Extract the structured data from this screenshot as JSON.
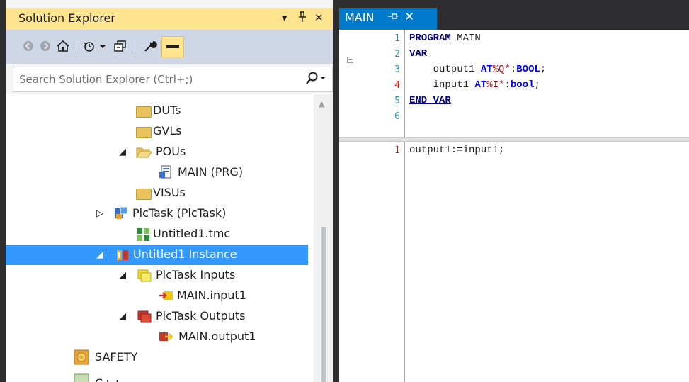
{
  "solution_explorer": {
    "title": "Solution Explorer",
    "dropdown_glyph": "▾",
    "pin_glyph": "ᛘ",
    "close_glyph": "✕",
    "search_placeholder": "Search Solution Explorer (Ctrl+;)",
    "toolbar_icons": [
      "back-icon",
      "forward-icon",
      "home-icon",
      "history-icon",
      "collapse-all-icon",
      "properties-icon",
      "preview-icon"
    ],
    "tree": [
      {
        "label": "DUTs",
        "icon": "folder-icon",
        "expander": ""
      },
      {
        "label": "GVLs",
        "icon": "folder-icon",
        "expander": ""
      },
      {
        "label": "POUs",
        "icon": "folder-open-icon",
        "expander": "◢"
      },
      {
        "label": "MAIN (PRG)",
        "icon": "program-icon",
        "expander": ""
      },
      {
        "label": "VISUs",
        "icon": "folder-icon",
        "expander": ""
      },
      {
        "label": "PlcTask (PlcTask)",
        "icon": "task-icon",
        "expander": "▷"
      },
      {
        "label": "Untitled1.tmc",
        "icon": "tmc-icon",
        "expander": ""
      },
      {
        "label": "Untitled1 Instance",
        "icon": "instance-icon",
        "expander": "◢",
        "selected": true
      },
      {
        "label": "PlcTask Inputs",
        "icon": "inputs-icon",
        "expander": "◢"
      },
      {
        "label": "MAIN.input1",
        "icon": "input-var-icon",
        "expander": ""
      },
      {
        "label": "PlcTask Outputs",
        "icon": "outputs-icon",
        "expander": "◢"
      },
      {
        "label": "MAIN.output1",
        "icon": "output-var-icon",
        "expander": ""
      },
      {
        "label": "SAFETY",
        "icon": "safety-icon",
        "expander": ""
      },
      {
        "label": "C++",
        "icon": "cpp-icon",
        "expander": ""
      }
    ]
  },
  "editor": {
    "tab_label": "MAIN",
    "tab_pin_glyph": "⊣",
    "tab_close_glyph": "✕",
    "declaration_lines": [
      {
        "num": "1",
        "red": false
      },
      {
        "num": "2",
        "red": false
      },
      {
        "num": "3",
        "red": false
      },
      {
        "num": "4",
        "red": true
      },
      {
        "num": "5",
        "red": false
      },
      {
        "num": "6",
        "red": false
      }
    ],
    "code": {
      "l1_kw": "PROGRAM",
      "l1_rest": " MAIN",
      "l2_kw": "VAR",
      "l3_name": "    output1 ",
      "l3_at": "AT",
      "l3_addr": "%Q*",
      "l3_colon": ":",
      "l3_type": "BOOL",
      "l3_end": ";",
      "l4_name": "    input1 ",
      "l4_at": "AT",
      "l4_addr": "%I*",
      "l4_colon": ":",
      "l4_type": "bool",
      "l4_end": ";",
      "l5_kw": "END_VAR"
    },
    "body_lines": [
      {
        "num": "1",
        "red": true
      }
    ],
    "body_code": "output1:=input1;"
  }
}
